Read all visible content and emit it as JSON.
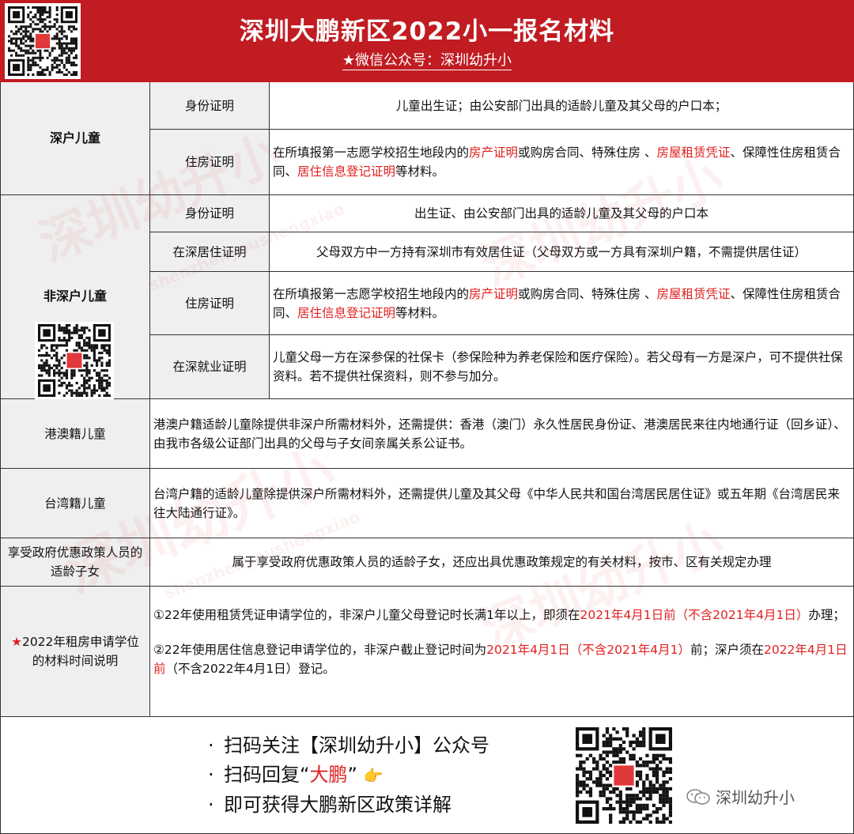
{
  "header": {
    "title": "深圳大鹏新区2022小一报名材料",
    "subtitle": "★微信公众号：深圳幼升小"
  },
  "watermark": {
    "main": "深圳幼升小",
    "pinyin": "shenzhenyoushengxiao",
    "small": "微信公众号："
  },
  "rows": {
    "shenhu": {
      "category": "深户儿童",
      "id_label": "身份证明",
      "id_text": "儿童出生证；由公安部门出具的适龄儿童及其父母的户口本；",
      "house_label": "住房证明",
      "house_parts": [
        "在所填报第一志愿学校招生地段内的",
        "房产证明",
        "或购房合同、特殊住房 、",
        "房屋租赁凭证",
        "、保障性住房租赁合同、",
        "居住信息登记证明",
        "等材料。"
      ]
    },
    "feishen": {
      "category": "非深户儿童",
      "id_label": "身份证明",
      "id_text": "出生证、由公安部门出具的适龄儿童及其父母的户口本",
      "residence_label": "在深居住证明",
      "residence_text": "父母双方中一方持有深圳市有效居住证（父母双方或一方具有深圳户籍，不需提供居住证）",
      "house_label": "住房证明",
      "house_parts": [
        "在所填报第一志愿学校招生地段内的",
        "房产证明",
        "或购房合同、特殊住房 、",
        "房屋租赁凭证",
        "、保障性住房租赁合同、",
        "居住信息登记证明",
        "等材料。"
      ],
      "job_label": "在深就业证明",
      "job_text": "儿童父母一方在深参保的社保卡（参保险种为养老保险和医疗保险）。若父母有一方是深户，可不提供社保资料。若不提供社保资料，则不参与加分。"
    },
    "gangao": {
      "category": "港澳籍儿童",
      "text": "港澳户籍适龄儿童除提供非深户所需材料外，还需提供：香港（澳门）永久性居民身份证、港澳居民来往内地通行证（回乡证）、由我市各级公证部门出具的父母与子女间亲属关系公证书。"
    },
    "taiwan": {
      "category": "台湾籍儿童",
      "text": "台湾户籍的适龄儿童除提供深户所需材料外，还需提供儿童及其父母《中华人民共和国台湾居民居住证》或五年期《台湾居民来往大陆通行证》。"
    },
    "youhui": {
      "category": "享受政府优惠政策人员的适龄子女",
      "text": "属于享受政府优惠政策人员的适龄子女，还应出具优惠政策规定的有关材料，按市、区有关规定办理"
    },
    "zufang": {
      "star": "★",
      "category": "2022年租房申请学位的材料时间说明",
      "p1_parts": [
        "①22年使用租赁凭证申请学位的，非深户儿童父母登记时长满1年以上，即须在",
        "2021年4月1日前（不含2021年4月1日）",
        "办理；"
      ],
      "p2_parts": [
        "②22年使用居住信息登记申请学位的，非深户截止登记时间为",
        "2021年4月1日（不含2021年4月1）",
        "前；深户须在",
        "2022年4月1日前",
        "（不含2022年4月1日）登记。"
      ]
    }
  },
  "footer": {
    "bullet_symbol": "·",
    "b1": "扫码关注【深圳幼升小】公众号",
    "b2_a": "扫码回复“",
    "b2_red": "大鹏",
    "b2_b": "”",
    "b2_icon": "👉",
    "b3": "即可获得大鹏新区政策详解",
    "brand": "深圳幼升小"
  },
  "colors": {
    "header_bg": "#c01c22",
    "highlight": "#e02020",
    "label_bg": "#efefef"
  }
}
